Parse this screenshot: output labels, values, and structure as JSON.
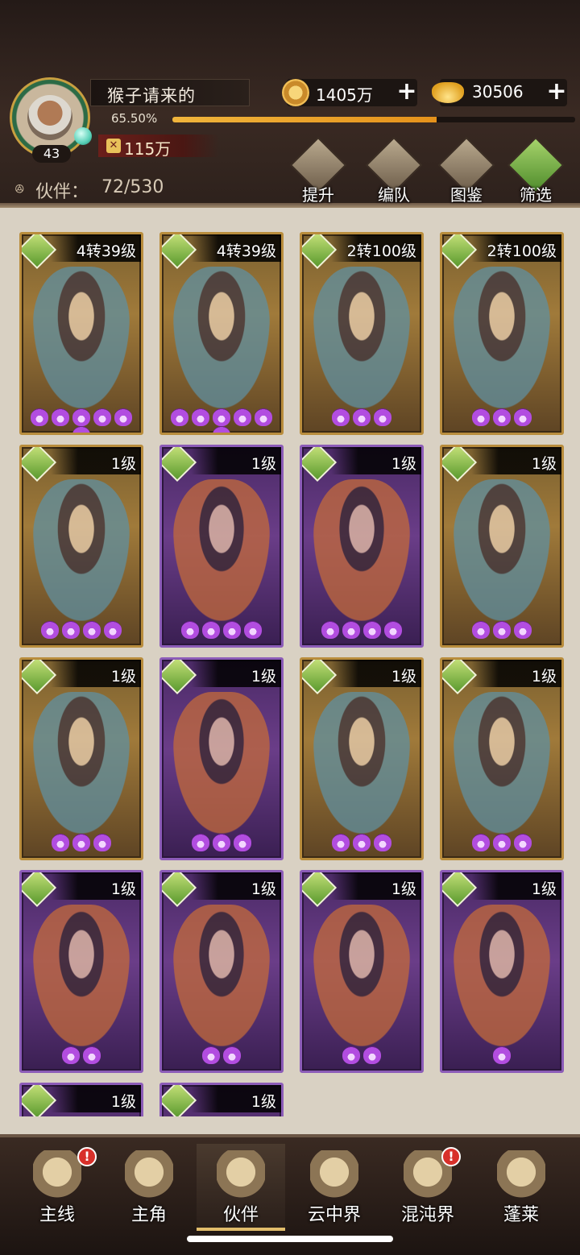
{
  "player": {
    "name": "猴子请来的",
    "level": "43",
    "exp_percent_text": "65.50%",
    "exp_fraction": 0.655,
    "power": "115万"
  },
  "currencies": {
    "coin": "1405万",
    "gold": "30506",
    "plus": "+"
  },
  "partners": {
    "label": "伙伴：",
    "count": "72/530"
  },
  "actions": [
    {
      "label": "提升",
      "icon": "upgrade-icon"
    },
    {
      "label": "编队",
      "icon": "formation-icon"
    },
    {
      "label": "图鉴",
      "icon": "codex-icon"
    },
    {
      "label": "筛选",
      "icon": "filter-icon"
    }
  ],
  "cards": [
    {
      "level": "4转39级",
      "rarity": "gold",
      "stars": 6
    },
    {
      "level": "4转39级",
      "rarity": "gold",
      "stars": 6
    },
    {
      "level": "2转100级",
      "rarity": "gold",
      "stars": 3
    },
    {
      "level": "2转100级",
      "rarity": "gold",
      "stars": 3
    },
    {
      "level": "1级",
      "rarity": "gold",
      "stars": 4
    },
    {
      "level": "1级",
      "rarity": "purple",
      "stars": 4
    },
    {
      "level": "1级",
      "rarity": "purple",
      "stars": 4
    },
    {
      "level": "1级",
      "rarity": "gold",
      "stars": 3
    },
    {
      "level": "1级",
      "rarity": "gold",
      "stars": 3
    },
    {
      "level": "1级",
      "rarity": "purple",
      "stars": 3
    },
    {
      "level": "1级",
      "rarity": "gold",
      "stars": 3
    },
    {
      "level": "1级",
      "rarity": "gold",
      "stars": 3
    },
    {
      "level": "1级",
      "rarity": "purple",
      "stars": 2
    },
    {
      "level": "1级",
      "rarity": "purple",
      "stars": 2
    },
    {
      "level": "1级",
      "rarity": "purple",
      "stars": 2
    },
    {
      "level": "1级",
      "rarity": "purple",
      "stars": 1
    },
    {
      "level": "1级",
      "rarity": "purple",
      "stars": 0
    },
    {
      "level": "1级",
      "rarity": "purple",
      "stars": 0
    }
  ],
  "nav": [
    {
      "label": "主线",
      "alert": "!",
      "active": false
    },
    {
      "label": "主角",
      "alert": "",
      "active": false
    },
    {
      "label": "伙伴",
      "alert": "",
      "active": true
    },
    {
      "label": "云中界",
      "alert": "",
      "active": false
    },
    {
      "label": "混沌界",
      "alert": "!",
      "active": false
    },
    {
      "label": "蓬莱",
      "alert": "",
      "active": false
    }
  ],
  "colors": {
    "gold_frame": "#b98d3d",
    "purple_frame": "#8c5cb8",
    "exp_bar": "#f0b53c",
    "alert": "#d8302a"
  }
}
